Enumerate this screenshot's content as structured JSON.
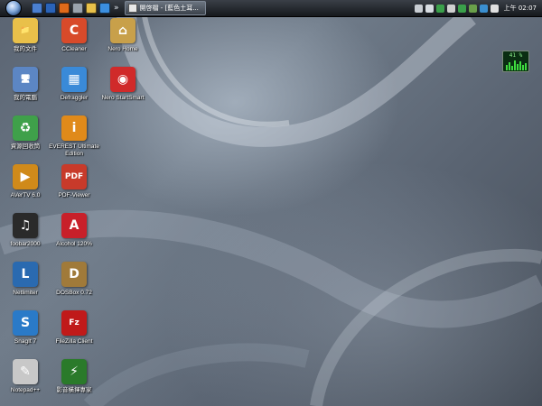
{
  "taskbar": {
    "quick_launch": [
      {
        "icon": "explorer-icon",
        "color": "#4a7fd0"
      },
      {
        "icon": "outlook-icon",
        "color": "#2a63b8"
      },
      {
        "icon": "firefox-icon",
        "color": "#e06a1a"
      },
      {
        "icon": "settings-icon",
        "color": "#9aa3ad"
      },
      {
        "icon": "folder-icon",
        "color": "#e8c14a"
      },
      {
        "icon": "ie-icon",
        "color": "#3b8fe0"
      }
    ],
    "more_label": "»",
    "task_button_label": "開啓檔 - [藍色土耳...",
    "tray_icons": [
      {
        "icon": "keyboard-icon",
        "color": "#c8cdd3"
      },
      {
        "icon": "network-icon",
        "color": "#d8dde3"
      },
      {
        "icon": "shield-icon",
        "color": "#3aa04a"
      },
      {
        "icon": "chevron-left-icon",
        "color": "#d0d0d0"
      },
      {
        "icon": "download-icon",
        "color": "#3aa04a"
      },
      {
        "icon": "user-icon",
        "color": "#6aa04a"
      },
      {
        "icon": "security-icon",
        "color": "#3a8fd0"
      },
      {
        "icon": "volume-icon",
        "color": "#e0e0e0"
      }
    ],
    "clock": "上午 02:07"
  },
  "desktop_icons": [
    {
      "name": "my-documents",
      "label": "我的文件",
      "glyph": "📁",
      "color": "#e9c04a"
    },
    {
      "name": "my-computer",
      "label": "我的電腦",
      "glyph": "🖥",
      "color": "#5c86c4"
    },
    {
      "name": "recycle-bin",
      "label": "資源回收筒",
      "glyph": "♻",
      "color": "#3fa04a"
    },
    {
      "name": "avertv",
      "label": "AVerTV 6.0",
      "glyph": "▶",
      "color": "#d08a1a"
    },
    {
      "name": "foobar2000",
      "label": "foobar2000",
      "glyph": "♫",
      "color": "#2a2a2a"
    },
    {
      "name": "netlimiter",
      "label": "Netlimiter",
      "glyph": "L",
      "color": "#2a6ab0"
    },
    {
      "name": "snagit",
      "label": "SnagIt 7",
      "glyph": "S",
      "color": "#2a7ac8"
    },
    {
      "name": "notepad-plus-plus",
      "label": "Notepad++",
      "glyph": "✎",
      "color": "#c8c8c8"
    },
    {
      "name": "ccleaner",
      "label": "CCleaner",
      "glyph": "C",
      "color": "#d84a2a"
    },
    {
      "name": "defraggler",
      "label": "Defraggler",
      "glyph": "▦",
      "color": "#3a8ad8"
    },
    {
      "name": "everest",
      "label": "EVEREST Ultimate Edition",
      "glyph": "i",
      "color": "#e08a1a"
    },
    {
      "name": "pdf-viewer",
      "label": "PDF-Viewer",
      "glyph": "PDF",
      "color": "#c83a2a"
    },
    {
      "name": "alcohol",
      "label": "Alcohol 120%",
      "glyph": "A",
      "color": "#c8202a"
    },
    {
      "name": "dosbox",
      "label": "DOSBox 0.72",
      "glyph": "D",
      "color": "#a07a3a"
    },
    {
      "name": "filezilla",
      "label": "FileZilla Client",
      "glyph": "Fz",
      "color": "#c01a1a"
    },
    {
      "name": "video-expert",
      "label": "影音橫揮專家",
      "glyph": "⚡",
      "color": "#2a7a2a"
    },
    {
      "name": "nero-home",
      "label": "Nero Home",
      "glyph": "⌂",
      "color": "#c8a04a"
    },
    {
      "name": "nero-startsmart",
      "label": "Nero StartSmart",
      "glyph": "◉",
      "color": "#d02a2a"
    }
  ],
  "cpu_gadget": {
    "text": "41 %"
  }
}
